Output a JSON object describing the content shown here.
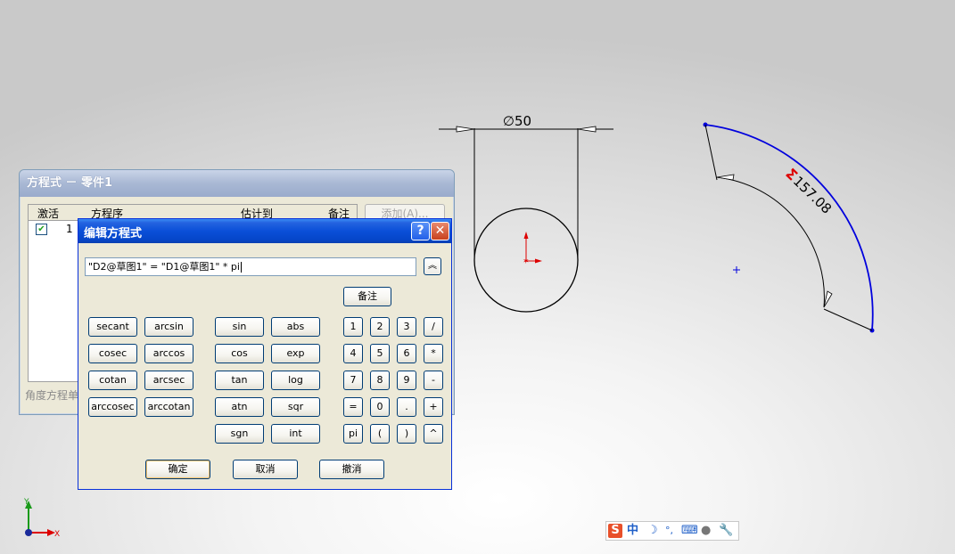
{
  "back_dialog": {
    "title": "方程式 － 零件1",
    "columns": [
      "激活",
      "方程序",
      "估计到",
      "备注"
    ],
    "rows": [
      {
        "active": true,
        "index": "1"
      }
    ],
    "add_button": "添加(A)...",
    "status": "角度方程单"
  },
  "edit_dialog": {
    "title": "编辑方程式",
    "help": "?",
    "close": "✕",
    "expression": "\"D2@草图1\" = \"D1@草图1\" * pi",
    "collapse_icon": "chevron-up-double-icon",
    "note_button": "备注",
    "functions_col1": [
      "secant",
      "cosec",
      "cotan",
      "arccosec"
    ],
    "functions_col2": [
      "arcsin",
      "arccos",
      "arcsec",
      "arccotan"
    ],
    "functions_col3": [
      "sin",
      "cos",
      "tan",
      "atn",
      "sgn"
    ],
    "functions_col4": [
      "abs",
      "exp",
      "log",
      "sqr",
      "int"
    ],
    "keypad": [
      [
        "1",
        "2",
        "3",
        "/"
      ],
      [
        "4",
        "5",
        "6",
        "*"
      ],
      [
        "7",
        "8",
        "9",
        "-"
      ],
      [
        "=",
        "0",
        ".",
        "+"
      ],
      [
        "pi",
        "(",
        ")",
        "^"
      ]
    ],
    "ok": "确定",
    "cancel": "取消",
    "undo": "撤消"
  },
  "drawing": {
    "diameter_label": "∅50",
    "arc_dim_symbol": "Σ",
    "arc_dim_value": "157.08",
    "axis_y": "Y",
    "axis_x": "X",
    "line_color": "#0000dd",
    "error_color": "#dd0000"
  },
  "ime": {
    "logo": "S",
    "mode": "中",
    "icons": [
      "moon-icon",
      "punctuation-icon",
      "keyboard-icon",
      "user-icon",
      "wrench-icon"
    ]
  }
}
